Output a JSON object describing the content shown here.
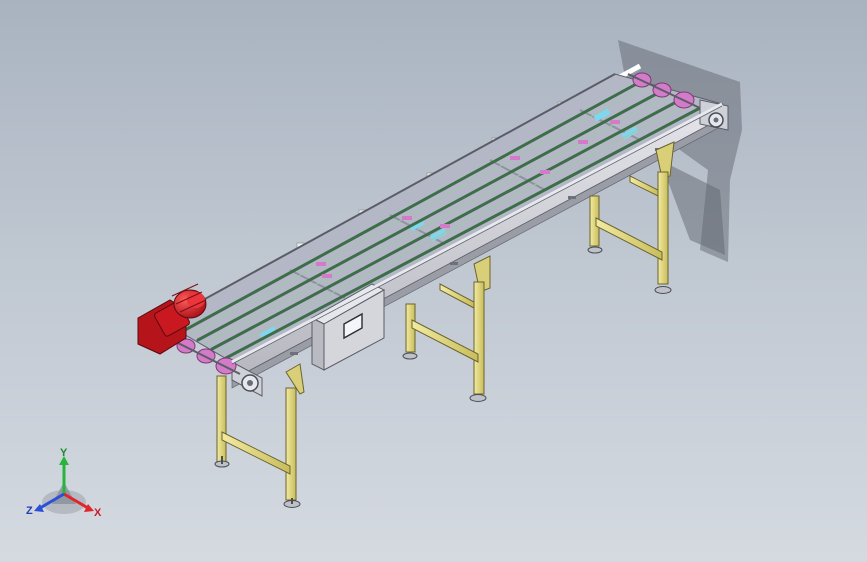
{
  "viewport": {
    "background_top": "#a9b3c0",
    "background_bottom": "#d5dae1"
  },
  "model": {
    "frame_color": "#c9c9cf",
    "leg_color": "#e6dc82",
    "belt_color": "#3d6e49",
    "motor_color": "#d2232a",
    "bearing_color": "#d37bc9",
    "guide_rail_color": "#ffffff",
    "control_box_color": "#d5d6dc"
  },
  "triad": {
    "x_label": "X",
    "y_label": "Y",
    "z_label": "Z",
    "x_color": "#e0262c",
    "y_color": "#27b43d",
    "z_color": "#2a4fd8"
  }
}
